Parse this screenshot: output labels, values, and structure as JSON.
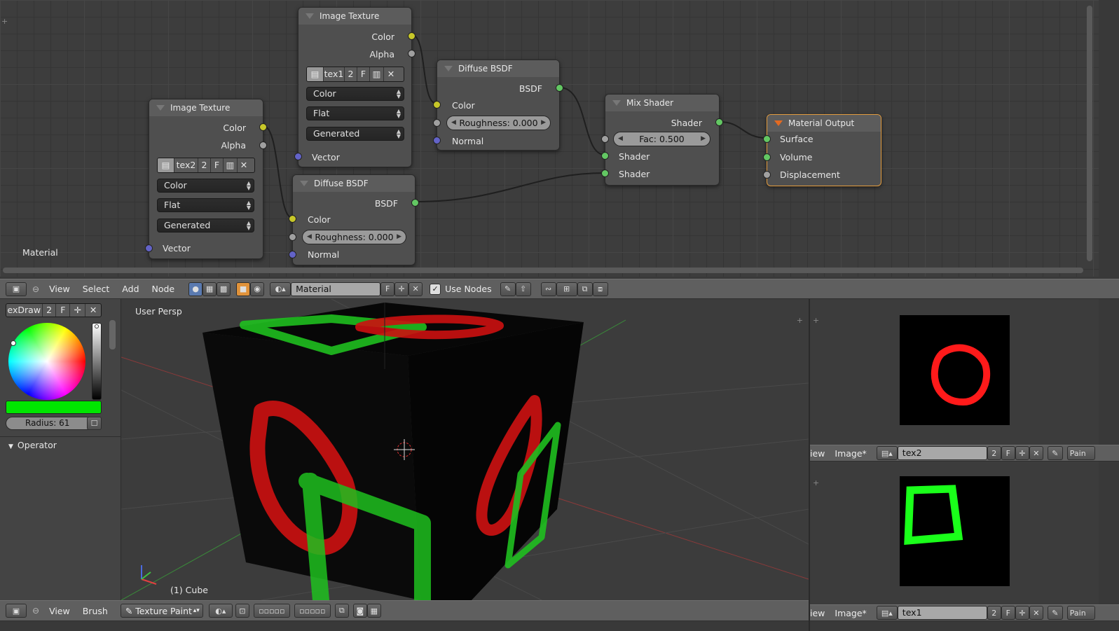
{
  "node_editor": {
    "context_label": "Material",
    "nodes": {
      "tex_a": {
        "title": "Image Texture",
        "out_color": "Color",
        "out_alpha": "Alpha",
        "image": "tex1",
        "users": "2",
        "fake": "F",
        "color_space": "Color",
        "projection": "Flat",
        "extension": "Generated",
        "in_vector": "Vector"
      },
      "tex_b": {
        "title": "Image Texture",
        "out_color": "Color",
        "out_alpha": "Alpha",
        "image": "tex2",
        "users": "2",
        "fake": "F",
        "color_space": "Color",
        "projection": "Flat",
        "extension": "Generated",
        "in_vector": "Vector"
      },
      "diff_a": {
        "title": "Diffuse BSDF",
        "out": "BSDF",
        "in_color": "Color",
        "roughness": "Roughness: 0.000",
        "in_normal": "Normal"
      },
      "diff_b": {
        "title": "Diffuse BSDF",
        "out": "BSDF",
        "in_color": "Color",
        "roughness": "Roughness: 0.000",
        "in_normal": "Normal"
      },
      "mix": {
        "title": "Mix Shader",
        "out": "Shader",
        "fac": "Fac: 0.500",
        "in1": "Shader",
        "in2": "Shader"
      },
      "output": {
        "title": "Material Output",
        "surface": "Surface",
        "volume": "Volume",
        "displacement": "Displacement"
      }
    }
  },
  "node_header": {
    "menus": [
      "View",
      "Select",
      "Add",
      "Node"
    ],
    "material_name": "Material",
    "fake": "F",
    "use_nodes_label": "Use Nodes",
    "use_nodes_checked": true
  },
  "tool_panel": {
    "brush_name": "exDraw",
    "users": "2",
    "fake": "F",
    "brush_color": "#00e600",
    "radius": "Radius: 61",
    "operator_label": "Operator"
  },
  "viewport": {
    "view_name": "User Persp",
    "object_label": "(1) Cube"
  },
  "viewport_header": {
    "menus": [
      "View",
      "Brush"
    ],
    "mode": "Texture Paint"
  },
  "image_editor_top": {
    "menu_partial": "iew",
    "image_menu": "Image*",
    "image_name": "tex2",
    "users": "2",
    "fake": "F",
    "paint_partial": "Pain",
    "stroke_color": "#ff1a1a"
  },
  "image_editor_bottom": {
    "menu_partial": "iew",
    "image_menu": "Image*",
    "image_name": "tex1",
    "users": "2",
    "fake": "F",
    "paint_partial": "Pain",
    "stroke_color": "#1aff1a"
  }
}
